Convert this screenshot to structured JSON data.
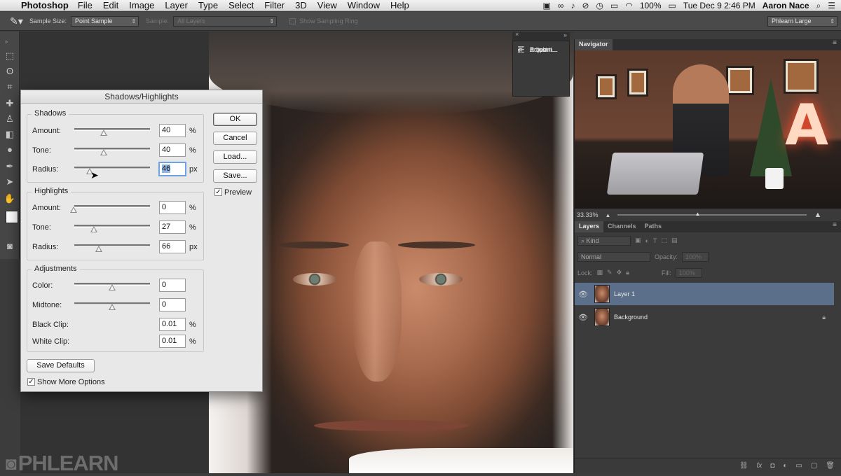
{
  "menubar": {
    "apple_icon": "apple-logo",
    "app_name": "Photoshop",
    "items": [
      "File",
      "Edit",
      "Image",
      "Layer",
      "Type",
      "Select",
      "Filter",
      "3D",
      "View",
      "Window",
      "Help"
    ],
    "battery": "100%",
    "datetime": "Tue Dec 9  2:46 PM",
    "user": "Aaron Nace",
    "search_icon": "search-icon",
    "list_icon": "list-icon"
  },
  "options": {
    "sample_size_label": "Sample Size:",
    "sample_size_value": "Point Sample",
    "sample_label": "Sample:",
    "sample_value": "All Layers",
    "sampling_ring_label": "Show Sampling Ring",
    "workspace": "Phlearn Large"
  },
  "mini_panel": {
    "items": [
      "Brush",
      "Adjustm...",
      "Properti..."
    ]
  },
  "navigator": {
    "tab": "Navigator",
    "zoom": "33.33%"
  },
  "layers_panel": {
    "tabs": [
      "Layers",
      "Channels",
      "Paths"
    ],
    "kind_label": "Kind",
    "blend_mode": "Normal",
    "opacity_label": "Opacity:",
    "opacity_value": "100%",
    "lock_label": "Lock:",
    "fill_label": "Fill:",
    "fill_value": "100%",
    "layers": [
      {
        "name": "Layer 1",
        "selected": true
      },
      {
        "name": "Background",
        "selected": false,
        "locked": true
      }
    ]
  },
  "dialog": {
    "title": "Shadows/Highlights",
    "shadows": {
      "title": "Shadows",
      "amount_label": "Amount:",
      "amount": "40",
      "amount_unit": "%",
      "tone_label": "Tone:",
      "tone": "40",
      "tone_unit": "%",
      "radius_label": "Radius:",
      "radius": "46",
      "radius_unit": "px"
    },
    "highlights": {
      "title": "Highlights",
      "amount_label": "Amount:",
      "amount": "0",
      "amount_unit": "%",
      "tone_label": "Tone:",
      "tone": "27",
      "tone_unit": "%",
      "radius_label": "Radius:",
      "radius": "66",
      "radius_unit": "px"
    },
    "adjustments": {
      "title": "Adjustments",
      "color_label": "Color:",
      "color": "0",
      "midtone_label": "Midtone:",
      "midtone": "0",
      "black_clip_label": "Black Clip:",
      "black_clip": "0.01",
      "black_clip_unit": "%",
      "white_clip_label": "White Clip:",
      "white_clip": "0.01",
      "white_clip_unit": "%"
    },
    "buttons": {
      "ok": "OK",
      "cancel": "Cancel",
      "load": "Load...",
      "save": "Save...",
      "save_defaults": "Save Defaults"
    },
    "preview_label": "Preview",
    "show_more_label": "Show More Options"
  },
  "watermark": "PHLEARN"
}
